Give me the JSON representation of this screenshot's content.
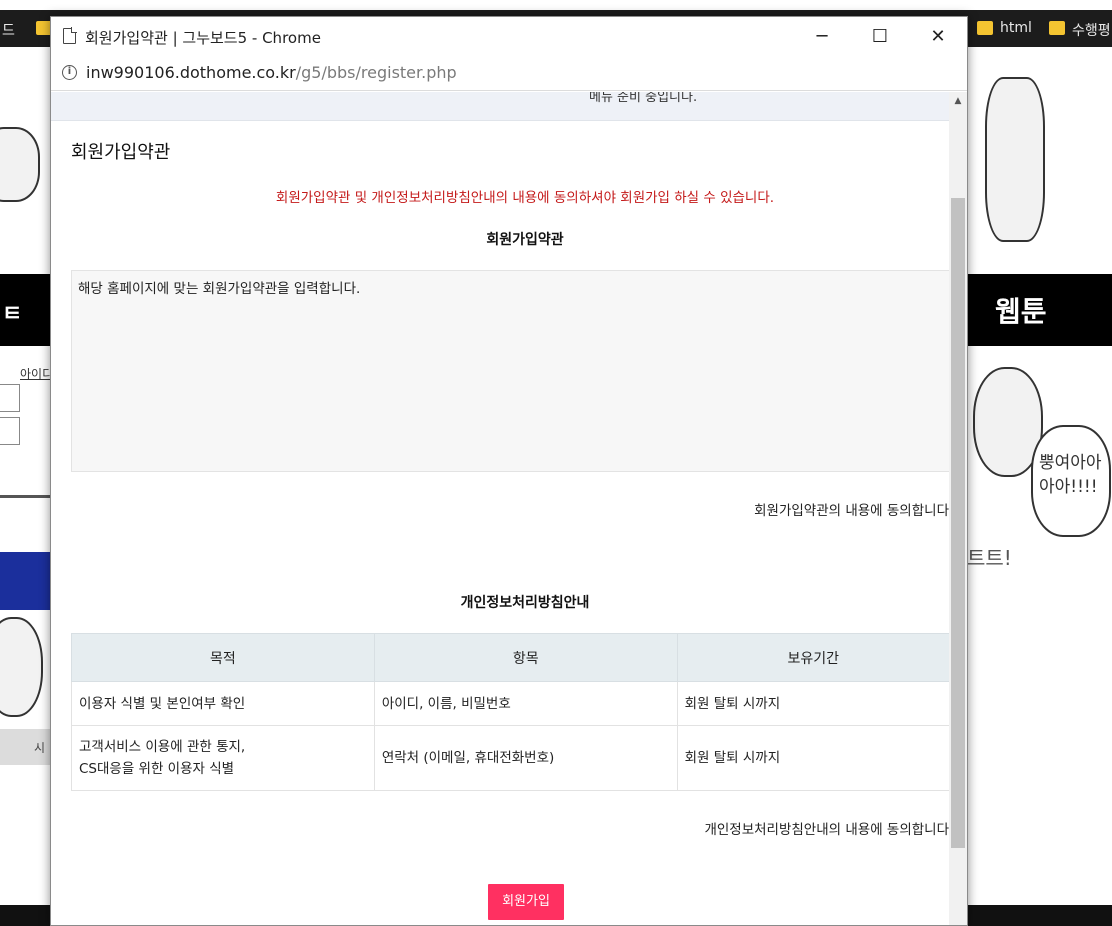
{
  "bookmarks": {
    "left_fragment": "드",
    "right_items": [
      "html",
      "수행평"
    ]
  },
  "background": {
    "left_band_text": "ㅌ",
    "left_link_text": "아이디",
    "left_gray_text": "시",
    "right_band_text": "웹툰",
    "right_bubble_text": "뿡여아아 아아!!!!",
    "right_sfx_text": "트트!"
  },
  "window": {
    "title": "회원가입약관 | 그누보드5 - Chrome",
    "minimize_glyph": "─",
    "maximize_glyph": "☐",
    "close_glyph": "✕"
  },
  "address": {
    "info_glyph": "i",
    "host": "inw990106.dothome.co.kr",
    "path": "/g5/bbs/register.php"
  },
  "page": {
    "notice_text": "메뉴 준비 중입니다.",
    "heading": "회원가입약관",
    "warning": "회원가입약관 및 개인정보처리방침안내의 내용에 동의하셔야 회원가입 하실 수 있습니다.",
    "terms_title": "회원가입약관",
    "terms_text": "해당 홈페이지에 맞는 회원가입약관을 입력합니다.",
    "terms_agree": "회원가입약관의 내용에 동의합니다",
    "privacy_title": "개인정보처리방침안내",
    "privacy_agree": "개인정보처리방침안내의 내용에 동의합니다",
    "submit_label": "회원가입",
    "scroll_up_glyph": "▲"
  },
  "privacy_table": {
    "headers": [
      "목적",
      "항목",
      "보유기간"
    ],
    "rows": [
      {
        "purpose_lines": [
          "이용자 식별 및 본인여부 확인"
        ],
        "items": "아이디, 이름, 비밀번호",
        "period": "회원 탈퇴 시까지"
      },
      {
        "purpose_lines": [
          "고객서비스 이용에 관한 통지,",
          "CS대응을 위한 이용자 식별"
        ],
        "items": "연락처 (이메일, 휴대전화번호)",
        "period": "회원 탈퇴 시까지"
      }
    ]
  },
  "colors": {
    "warning": "#c41a1a",
    "submit_bg": "#ff3061",
    "table_header_bg": "#e6edf0",
    "notice_bg": "#eef1f7"
  }
}
